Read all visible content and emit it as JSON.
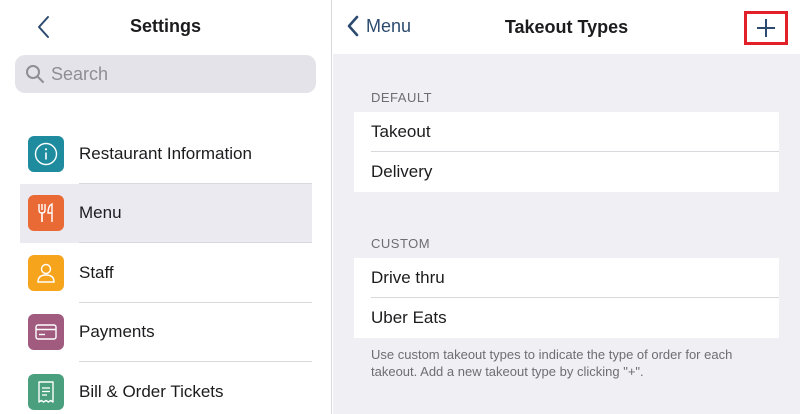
{
  "sidebar": {
    "title": "Settings",
    "search_placeholder": "Search",
    "items": [
      {
        "label": "Restaurant Information",
        "icon": "info-icon",
        "color": "#1e8c9e"
      },
      {
        "label": "Menu",
        "icon": "fork-knife-icon",
        "color": "#ea6a35",
        "selected": true
      },
      {
        "label": "Staff",
        "icon": "person-icon",
        "color": "#f7a41d"
      },
      {
        "label": "Payments",
        "icon": "card-icon",
        "color": "#a05b7f"
      },
      {
        "label": "Bill & Order Tickets",
        "icon": "receipt-icon",
        "color": "#4aa07e"
      }
    ]
  },
  "detail": {
    "back_label": "Menu",
    "title": "Takeout Types",
    "add_label": "+",
    "sections": [
      {
        "header": "DEFAULT",
        "items": [
          "Takeout",
          "Delivery"
        ]
      },
      {
        "header": "CUSTOM",
        "items": [
          "Drive thru",
          "Uber Eats"
        ]
      }
    ],
    "footer": "Use custom takeout types to indicate the type of order for each takeout. Add a new takeout type by clicking \"+\"."
  },
  "colors": {
    "accent": "#2c4a6e",
    "highlight_border": "#e2202a",
    "selected_row": "#eceaf1"
  }
}
